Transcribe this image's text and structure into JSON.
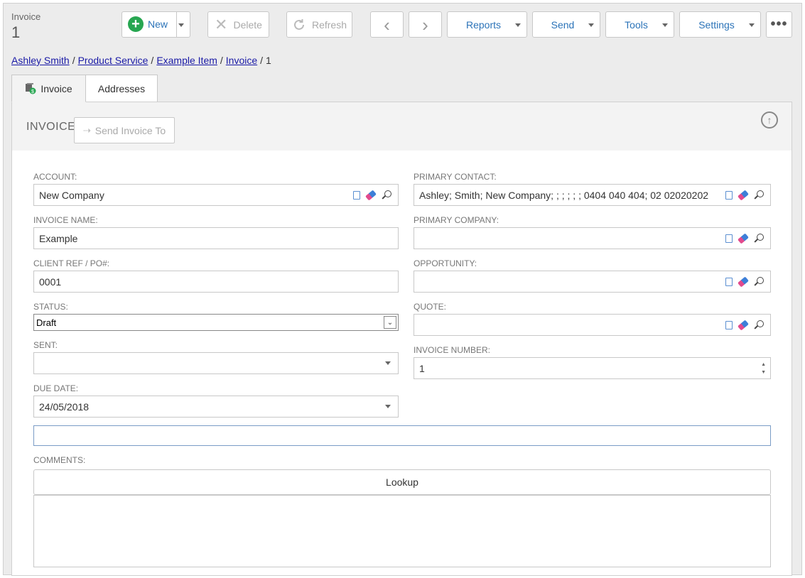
{
  "header": {
    "record_type": "Invoice",
    "record_number": "1"
  },
  "toolbar": {
    "new_label": "New",
    "delete_label": "Delete",
    "refresh_label": "Refresh",
    "reports_label": "Reports",
    "send_label": "Send",
    "tools_label": "Tools",
    "settings_label": "Settings",
    "more_label": "•••"
  },
  "breadcrumb": {
    "items": [
      "Ashley Smith",
      "Product Service",
      "Example Item",
      "Invoice"
    ],
    "current": "1",
    "separator": "/"
  },
  "tabs": [
    {
      "label": "Invoice",
      "icon": "invoice-icon",
      "active": true
    },
    {
      "label": "Addresses",
      "active": false
    }
  ],
  "section": {
    "title": "INVOICE",
    "send_invoice_to_label": "Send Invoice To"
  },
  "fields": {
    "account": {
      "label": "ACCOUNT:",
      "value": "New Company"
    },
    "invoice_name": {
      "label": "INVOICE NAME:",
      "value": "Example"
    },
    "client_ref": {
      "label": "CLIENT REF / PO#:",
      "value": "0001"
    },
    "status": {
      "label": "STATUS:",
      "value": "Draft"
    },
    "sent": {
      "label": "SENT:",
      "value": ""
    },
    "due_date": {
      "label": "DUE DATE:",
      "value": "24/05/2018"
    },
    "primary_contact": {
      "label": "PRIMARY CONTACT:",
      "value": "Ashley; Smith; New Company; ; ; ; ; ; 0404 040 404; 02 02020202"
    },
    "primary_company": {
      "label": "PRIMARY COMPANY:",
      "value": ""
    },
    "opportunity": {
      "label": "OPPORTUNITY:",
      "value": ""
    },
    "quote": {
      "label": "QUOTE:",
      "value": ""
    },
    "invoice_number": {
      "label": "INVOICE NUMBER:",
      "value": "1"
    },
    "comments": {
      "label": "COMMENTS:",
      "lookup_label": "Lookup"
    }
  },
  "colors": {
    "accent": "#2b73b8",
    "new_green": "#27a651",
    "link": "#1a1aa6",
    "eraser_pink": "#e24a8d",
    "eraser_blue": "#3d7fd8"
  }
}
